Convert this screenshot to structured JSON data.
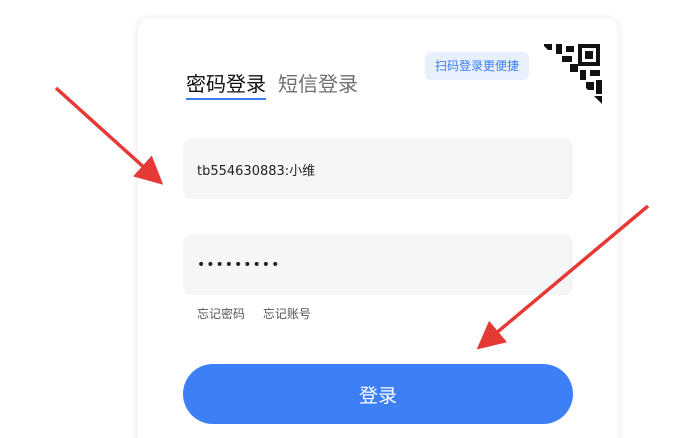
{
  "tabs": [
    {
      "label": "密码登录",
      "active": true
    },
    {
      "label": "短信登录",
      "active": false
    }
  ],
  "qr_tip": "扫码登录更便捷",
  "account": {
    "value": "tb554630883:小维"
  },
  "password": {
    "value": "•••••••••"
  },
  "links": {
    "forgot_password": "忘记密码",
    "forgot_account": "忘记账号"
  },
  "login_button": "登录",
  "colors": {
    "accent": "#3d7ff7",
    "arrow": "#e53935",
    "field_bg": "#f5f6f8"
  },
  "icons": [
    "qr-code-corner-icon",
    "red-annotation-arrow"
  ]
}
